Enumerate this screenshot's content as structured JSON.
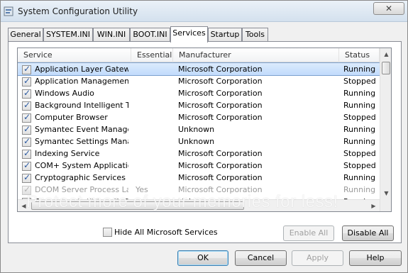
{
  "window": {
    "title": "System Configuration Utility",
    "close_glyph": "✕"
  },
  "tabs": [
    {
      "label": "General",
      "active": false
    },
    {
      "label": "SYSTEM.INI",
      "active": false
    },
    {
      "label": "WIN.INI",
      "active": false
    },
    {
      "label": "BOOT.INI",
      "active": false
    },
    {
      "label": "Services",
      "active": true
    },
    {
      "label": "Startup",
      "active": false
    },
    {
      "label": "Tools",
      "active": false
    }
  ],
  "services": {
    "columns": {
      "service": "Service",
      "essential": "Essential",
      "manufacturer": "Manufacturer",
      "status": "Status"
    },
    "rows": [
      {
        "name": "Application Layer Gatew…",
        "essential": "",
        "manufacturer": "Microsoft Corporation",
        "status": "Running",
        "checked": true,
        "selected": true,
        "disabled": false
      },
      {
        "name": "Application Management",
        "essential": "",
        "manufacturer": "Microsoft Corporation",
        "status": "Stopped",
        "checked": true,
        "selected": false,
        "disabled": false
      },
      {
        "name": "Windows Audio",
        "essential": "",
        "manufacturer": "Microsoft Corporation",
        "status": "Running",
        "checked": true,
        "selected": false,
        "disabled": false
      },
      {
        "name": "Background Intelligent T…",
        "essential": "",
        "manufacturer": "Microsoft Corporation",
        "status": "Running",
        "checked": true,
        "selected": false,
        "disabled": false
      },
      {
        "name": "Computer Browser",
        "essential": "",
        "manufacturer": "Microsoft Corporation",
        "status": "Stopped",
        "checked": true,
        "selected": false,
        "disabled": false
      },
      {
        "name": "Symantec Event Manager",
        "essential": "",
        "manufacturer": "Unknown",
        "status": "Running",
        "checked": true,
        "selected": false,
        "disabled": false
      },
      {
        "name": "Symantec Settings Mana…",
        "essential": "",
        "manufacturer": "Unknown",
        "status": "Running",
        "checked": true,
        "selected": false,
        "disabled": false
      },
      {
        "name": "Indexing Service",
        "essential": "",
        "manufacturer": "Microsoft Corporation",
        "status": "Stopped",
        "checked": true,
        "selected": false,
        "disabled": false
      },
      {
        "name": "COM+ System Application",
        "essential": "",
        "manufacturer": "Microsoft Corporation",
        "status": "Stopped",
        "checked": true,
        "selected": false,
        "disabled": false
      },
      {
        "name": "Cryptographic Services",
        "essential": "",
        "manufacturer": "Microsoft Corporation",
        "status": "Running",
        "checked": true,
        "selected": false,
        "disabled": false
      },
      {
        "name": "DCOM Server Process La…",
        "essential": "Yes",
        "manufacturer": "Microsoft Corporation",
        "status": "Running",
        "checked": true,
        "selected": false,
        "disabled": true
      },
      {
        "name": "Symantec AntiVirus Defi…",
        "essential": "",
        "manufacturer": "Unknown",
        "status": "Running",
        "checked": true,
        "selected": false,
        "disabled": false
      }
    ]
  },
  "watermark": "Protect more of your memories for less!",
  "hide_ms_label": "Hide All Microsoft Services",
  "buttons": {
    "enable_all": "Enable All",
    "disable_all": "Disable All",
    "ok": "OK",
    "cancel": "Cancel",
    "apply": "Apply",
    "help": "Help"
  }
}
